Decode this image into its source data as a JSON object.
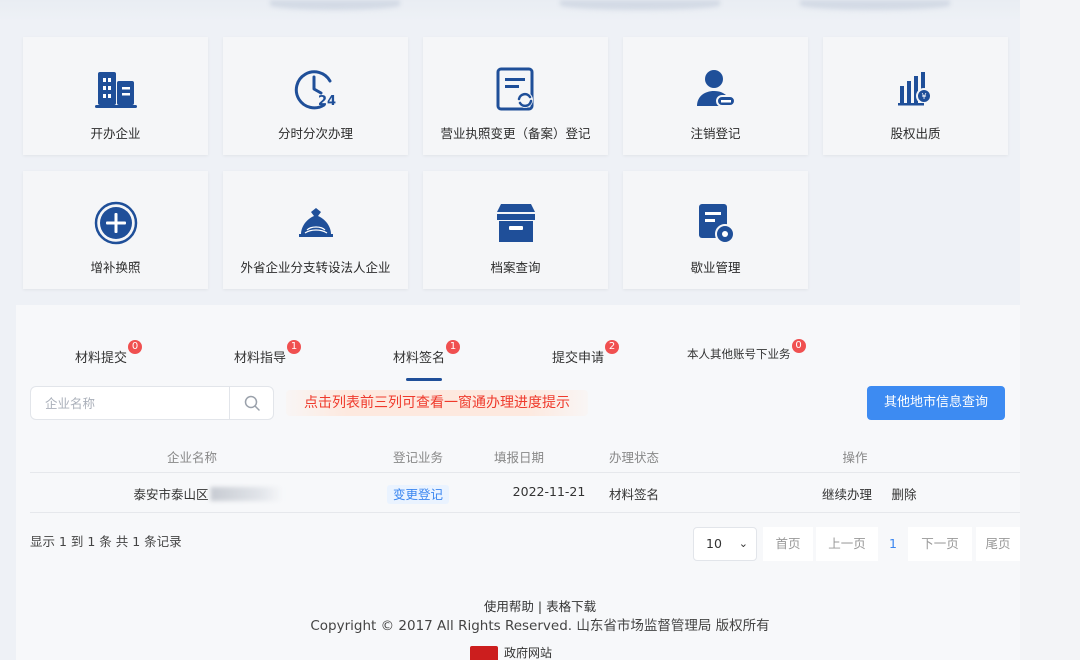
{
  "services": [
    {
      "label": "开办企业",
      "icon": "building-icon"
    },
    {
      "label": "分时分次办理",
      "icon": "clock-24-icon"
    },
    {
      "label": "营业执照变更（备案）登记",
      "icon": "document-refresh-icon"
    },
    {
      "label": "注销登记",
      "icon": "user-remove-icon"
    },
    {
      "label": "股权出质",
      "icon": "bar-chart-icon"
    },
    {
      "label": "增补换照",
      "icon": "plus-circle-icon"
    },
    {
      "label": "外省企业分支转设法人企业",
      "icon": "money-bag-icon"
    },
    {
      "label": "档案查询",
      "icon": "archive-box-icon"
    },
    {
      "label": "歇业管理",
      "icon": "document-gear-icon"
    }
  ],
  "tabs": [
    {
      "label": "材料提交",
      "badge": "0"
    },
    {
      "label": "材料指导",
      "badge": "1"
    },
    {
      "label": "材料签名",
      "badge": "1"
    },
    {
      "label": "提交申请",
      "badge": "2"
    },
    {
      "label": "本人其他账号下业务",
      "badge": "0"
    }
  ],
  "search": {
    "placeholder": "企业名称"
  },
  "hint": "点击列表前三列可查看一窗通办理进度提示",
  "query_button": "其他地市信息查询",
  "table": {
    "headers": [
      "企业名称",
      "登记业务",
      "填报日期",
      "办理状态",
      "操作"
    ],
    "rows": [
      {
        "name": "泰安市泰山区",
        "business": "变更登记",
        "date": "2022-11-21",
        "status": "材料签名",
        "actions": [
          "继续办理",
          "删除"
        ]
      }
    ]
  },
  "summary": "显示 1 到 1 条 共 1 条记录",
  "pagination": {
    "page_size": "10",
    "first": "首页",
    "prev": "上一页",
    "current": "1",
    "next": "下一页",
    "last": "尾页"
  },
  "footer": {
    "links": "使用帮助 | 表格下载",
    "copyright": "Copyright © 2017 All Rights Reserved. 山东省市场监督管理局 版权所有",
    "badge_text": "政府网站"
  },
  "colors": {
    "icon_blue": "#1f4f99",
    "primary_button": "#3d8bf2",
    "badge_red": "#f05050",
    "hint_red": "#ef3a2c"
  }
}
